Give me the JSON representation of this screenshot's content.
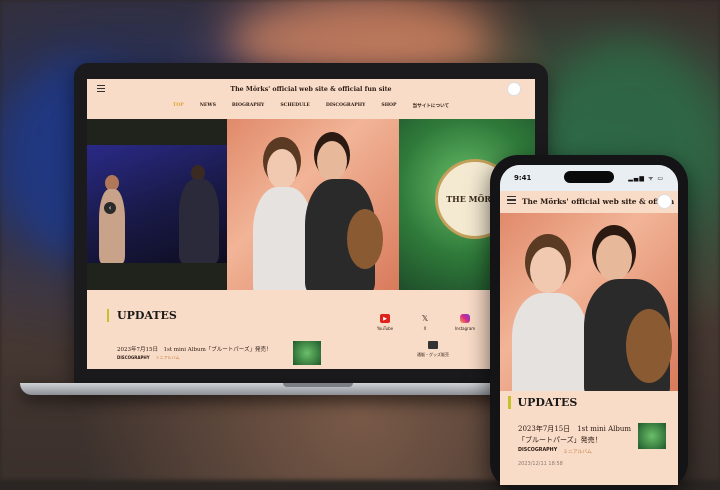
{
  "site": {
    "title": "The Mörks' official web site & official fun site",
    "mobile_title": "The Mörks' official web site & officia"
  },
  "nav": {
    "items": [
      "TOP",
      "NEWS",
      "BIOGRAPHY",
      "SCHEDULE",
      "DISCOGRAPHY",
      "SHOP",
      "当サイトについて"
    ],
    "active_color": "#d9a52f"
  },
  "hero": {
    "badge_text": "THE MÖRKS",
    "prev_arrow": "‹"
  },
  "updates": {
    "heading": "UPDATES",
    "items": [
      {
        "text": "2023年7月15日　1st mini Album「ブルートパーズ」発売！",
        "category": "DISCOGRAPHY",
        "sub": "ミニアルバム",
        "date": "2023/12/11 18:58"
      }
    ]
  },
  "socials": [
    {
      "label": "YouTube",
      "icon": "youtube-icon"
    },
    {
      "label": "X",
      "icon": "x-icon"
    },
    {
      "label": "Instagram",
      "icon": "instagram-icon"
    }
  ],
  "shop_link": {
    "label": "通販・グッズ販売",
    "icon": "store-icon"
  },
  "phone": {
    "time": "9:41",
    "status": "▂▄▆ ᯤ ▭"
  },
  "colors": {
    "page_bg": "#f9dcc8",
    "accent_bar": "#c5c12a"
  }
}
